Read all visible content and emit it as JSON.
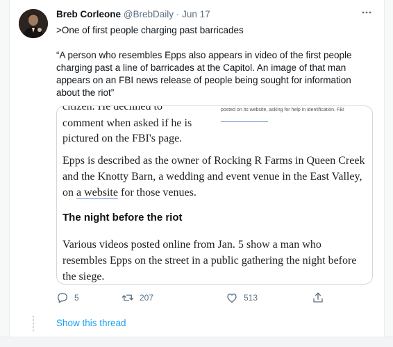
{
  "tweet": {
    "display_name": "Breb Corleone",
    "handle": "@BrebDaily",
    "separator": "·",
    "date": "Jun 17",
    "more_icon": "more-horizontal-icon",
    "text_line": ">One of first people charging past barricades",
    "quote": "“A person who resembles Epps also appears in video of the first people charging past a line of barricades at the Capitol. An image of that man appears on an FBI news release of people being sought for information about the riot”"
  },
  "media": {
    "clipped_line": "citizen. He declined to",
    "left_text": "comment when asked if he is pictured on the FBI's page.",
    "caption": "posted on its website, asking for help in identification. FBI",
    "paragraph1_before": "Epps is described as the owner of Rocking R Farms in Queen Creek and the Knotty Barn, a wedding and event venue in the East Valley, on ",
    "paragraph1_link": "a website",
    "paragraph1_after": " for those venues.",
    "subhead": "The night before the riot",
    "paragraph2": "Various videos posted online from Jan. 5 show a man who resembles Epps on the street in a public gathering the night before the siege."
  },
  "actions": {
    "reply_count": "5",
    "retweet_count": "207",
    "like_count": "513"
  },
  "show_thread": "Show this thread",
  "colors": {
    "accent": "#1da1f2",
    "secondary_text": "#5b7083",
    "border": "#cfd9de"
  }
}
